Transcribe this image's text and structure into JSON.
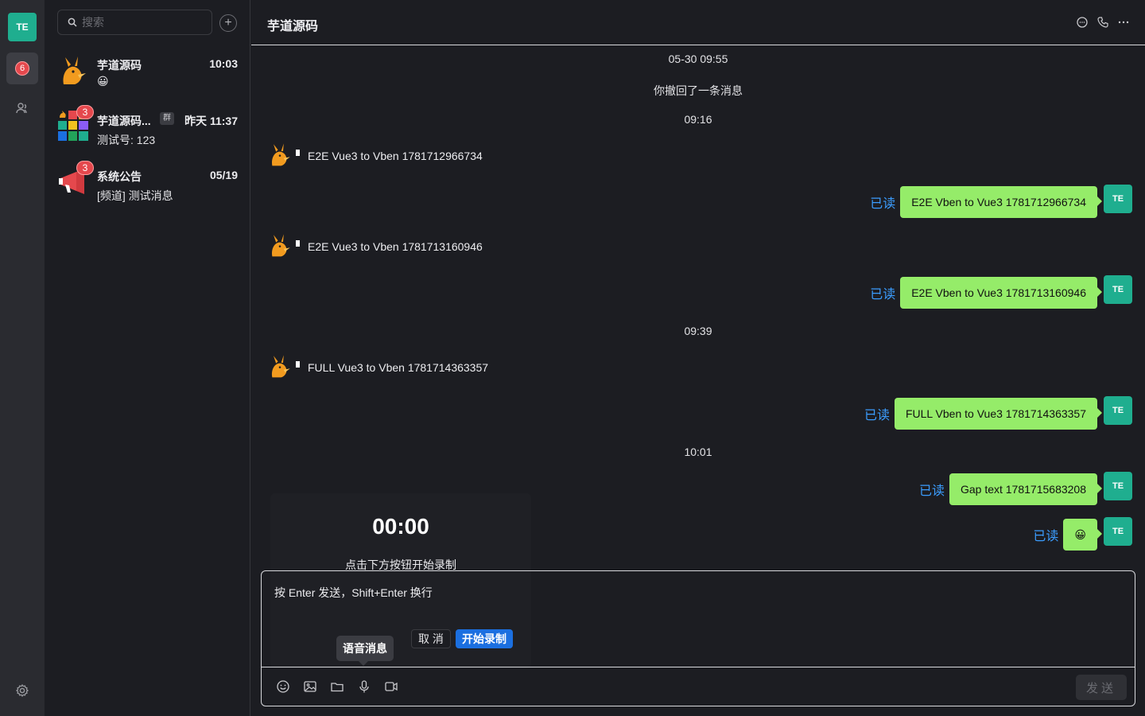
{
  "rail": {
    "avatar_text": "TE",
    "unread_count": "6",
    "accent_color": "#1fae8f"
  },
  "search": {
    "placeholder": "搜索"
  },
  "conversations": [
    {
      "name": "芋道源码",
      "time": "10:03",
      "preview": "😀",
      "avatar": "mascot-icon"
    },
    {
      "name": "芋道源码...",
      "tag": "群",
      "time": "昨天 11:37",
      "preview": "测试号: 123",
      "unread": "3",
      "avatar": "group-grid-icon"
    },
    {
      "name": "系统公告",
      "time": "05/19",
      "preview": "[频道] 测试消息",
      "unread": "3",
      "avatar": "megaphone-icon"
    }
  ],
  "chat": {
    "title": "芋道源码",
    "system": [
      "05-30 09:55",
      "你撤回了一条消息",
      "09:16",
      "09:39",
      "10:01"
    ],
    "incoming": [
      "E2E Vue3 to Vben 1781712966734",
      "E2E Vue3 to Vben 1781713160946",
      "FULL Vue3 to Vben 1781714363357"
    ],
    "outgoing": [
      {
        "status": "已读",
        "text": "E2E Vben to Vue3 1781712966734"
      },
      {
        "status": "已读",
        "text": "E2E Vben to Vue3 1781713160946"
      },
      {
        "status": "已读",
        "text": "FULL Vben to Vue3 1781714363357"
      },
      {
        "status": "已读",
        "text": "Gap text 1781715683208"
      },
      {
        "status": "已读",
        "text": "😀"
      }
    ],
    "me_avatar": "TE"
  },
  "recorder": {
    "time": "00:00",
    "hint": "点击下方按钮开始录制",
    "cancel_label": "取 消",
    "start_label": "开始录制"
  },
  "composer": {
    "placeholder": "按 Enter 发送，Shift+Enter 换行",
    "send_label": "发送",
    "tooltip": "语音消息"
  },
  "colors": {
    "bubble_out": "#95ec69",
    "read_status": "#3b9dff",
    "primary_button": "#1b6fe0",
    "badge": "#e5484d"
  }
}
